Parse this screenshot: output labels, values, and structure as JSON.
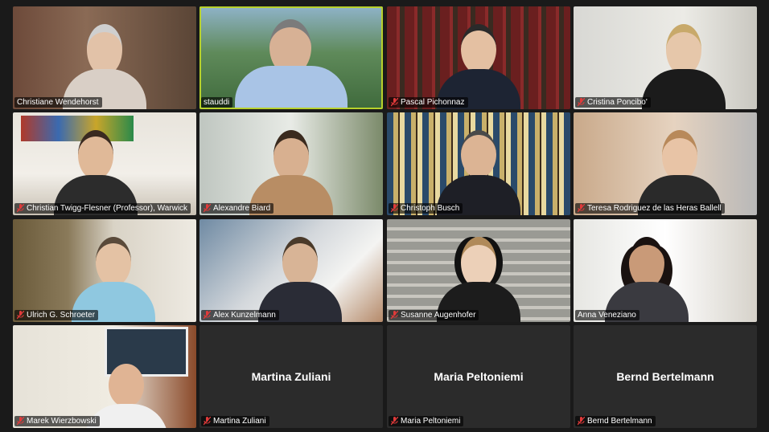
{
  "participants": [
    {
      "name": "Christiane Wendehorst",
      "muted": false
    },
    {
      "name": "stauddi",
      "muted": false,
      "active": true
    },
    {
      "name": "Pascal Pichonnaz",
      "muted": true
    },
    {
      "name": "Cristina Poncibo'",
      "muted": true
    },
    {
      "name": "Christian Twigg-Flesner (Professor), Warwick",
      "muted": true
    },
    {
      "name": "Alexandre Biard",
      "muted": true
    },
    {
      "name": "Christoph Busch",
      "muted": true
    },
    {
      "name": "Teresa Rodriguez de las Heras Ballell",
      "muted": true
    },
    {
      "name": "Ulrich G. Schroeter",
      "muted": true
    },
    {
      "name": "Alex Kunzelmann",
      "muted": true
    },
    {
      "name": "Susanne Augenhofer",
      "muted": true
    },
    {
      "name": "Anna Veneziano",
      "muted": false
    },
    {
      "name": "Marek Wierzbowski",
      "muted": true
    },
    {
      "name": "Martina Zuliani",
      "muted": true,
      "video_off": true
    },
    {
      "name": "Maria Peltoniemi",
      "muted": true,
      "video_off": true
    },
    {
      "name": "Bernd Bertelmann",
      "muted": true,
      "video_off": true
    }
  ],
  "colors": {
    "active_border": "#b8d12b",
    "muted_icon": "#e03a3a",
    "background": "#1a1a1a",
    "tile": "#2b2b2b"
  }
}
